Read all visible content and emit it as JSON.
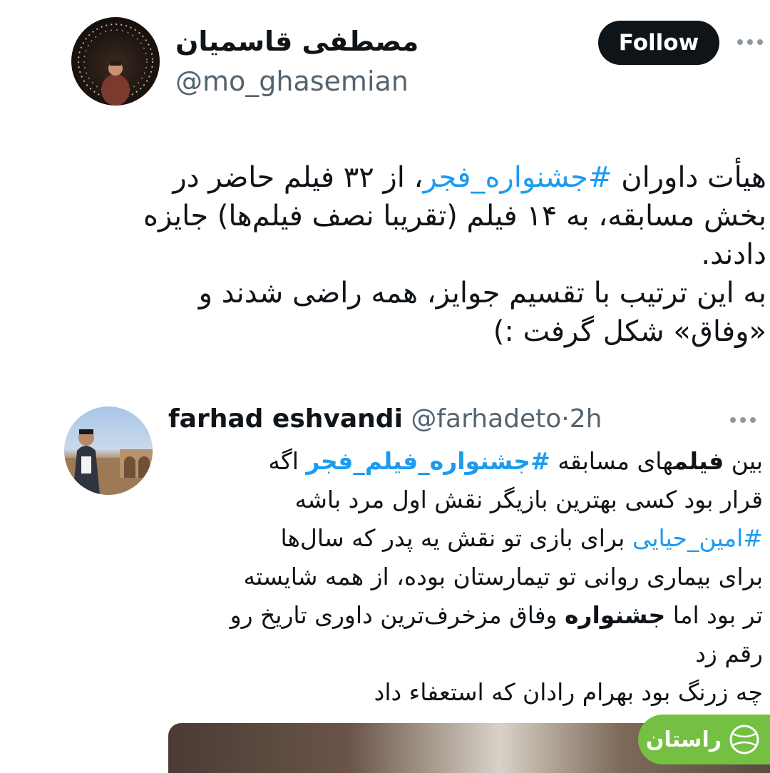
{
  "author": {
    "name": "مصطفی قاسمیان",
    "handle": "@mo_ghasemian"
  },
  "follow_label": "Follow",
  "tweet": {
    "lines": [
      {
        "before": "هیأت داوران ",
        "tag": "#جشنواره_فجر",
        "after": "، از ۳۲ فیلم حاضر در"
      },
      {
        "text": "بخش مسابقه، به ۱۴ فیلم (تقریبا نصف فیلم‌ها) جایزه"
      },
      {
        "text": "دادند."
      },
      {
        "text": "به این ترتیب با تقسیم جوایز، همه راضی شدند و"
      },
      {
        "text": "«وفاق» شکل گرفت :)"
      }
    ]
  },
  "quoted": {
    "name": "farhad eshvandi",
    "handle": "@farhadeto",
    "separator": "·",
    "time": "2h",
    "lines": {
      "l1_a": "بین ",
      "l1_b": "فیلم",
      "l1_c": "های مسابقه  ",
      "l1_tag": "#جشنواره_فیلم_فجر",
      "l1_d": " اگه",
      "l2": "قرار بود کسی بهترین بازیگر نقش اول مرد باشه",
      "l3_tag": "#امین_حیایی",
      "l3_rest": " برای بازی تو نقش یه پدر که سال‌ها",
      "l4": "برای بیماری روانی تو تیمارستان بوده، از همه شایسته",
      "l5_a": "تر بود اما ",
      "l5_b": "جشنواره",
      "l5_c": " وفاق مزخرف‌ترین داوری تاریخ رو",
      "l6": "رقم زد",
      "l7": "چه زرنگ بود بهرام رادان که استعفاء داد"
    }
  },
  "watermark": {
    "text": "راستان"
  },
  "colors": {
    "accent": "#1d9bf0",
    "text": "#0f1419",
    "muted": "#536471",
    "watermark": "#74c043"
  },
  "icons": {
    "more": "more-horizontal-icon",
    "logo": "tennis-ball-icon"
  }
}
